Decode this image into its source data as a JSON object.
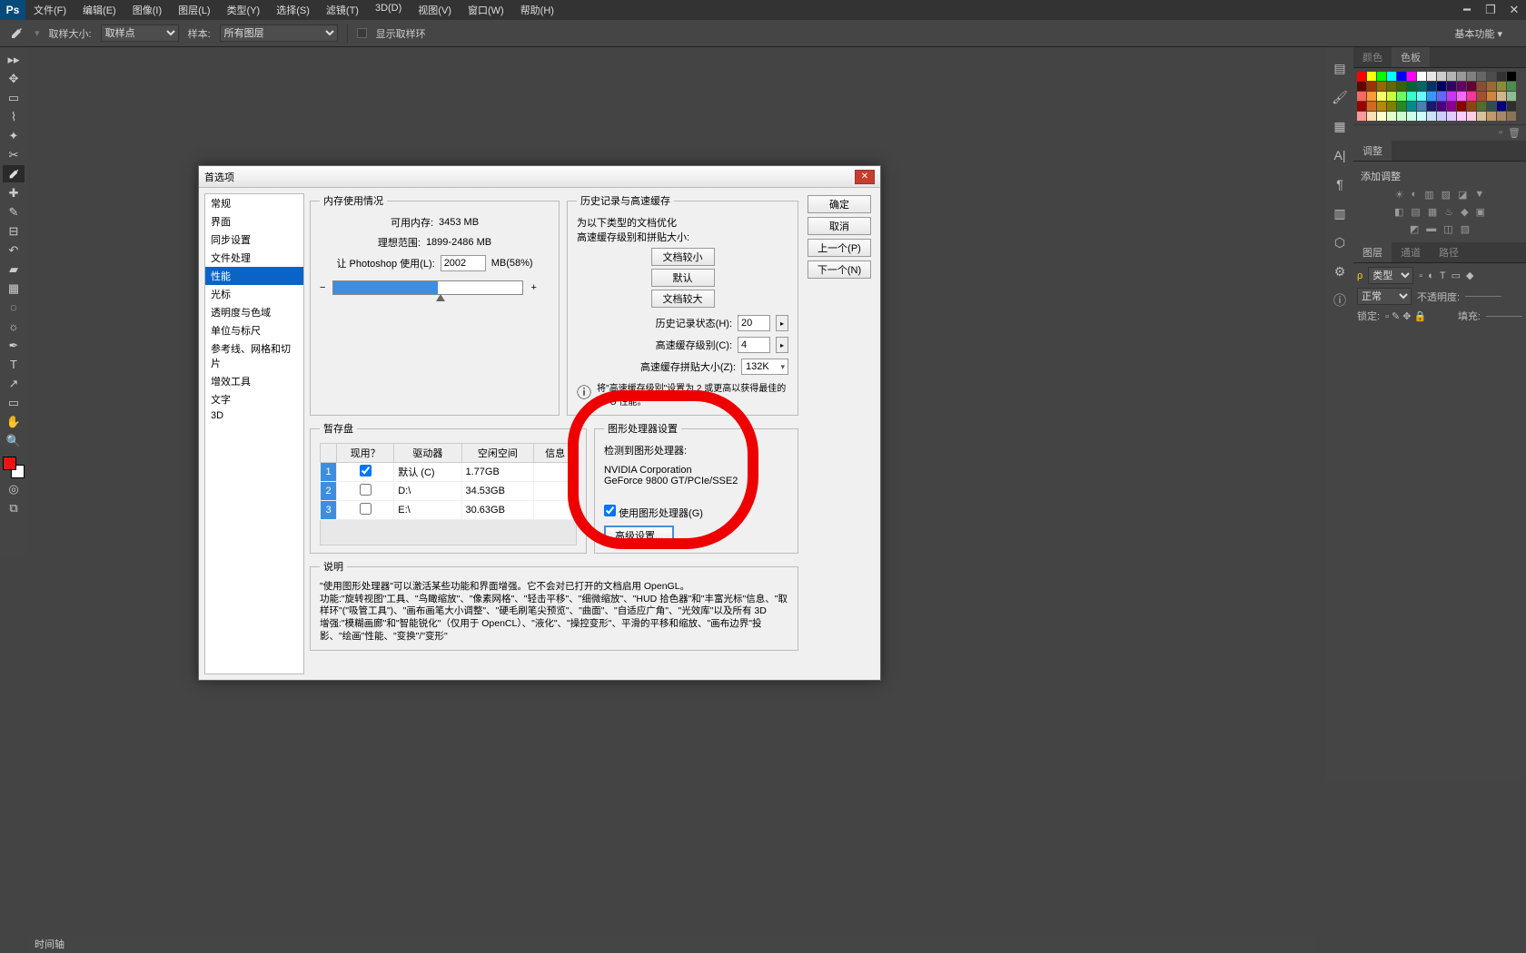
{
  "menu": [
    "文件(F)",
    "编辑(E)",
    "图像(I)",
    "图层(L)",
    "类型(Y)",
    "选择(S)",
    "滤镜(T)",
    "3D(D)",
    "视图(V)",
    "窗口(W)",
    "帮助(H)"
  ],
  "options_bar": {
    "sample_size_label": "取样大小:",
    "sample_size_value": "取样点",
    "sample_label": "样本:",
    "sample_value": "所有图层",
    "show_ring": "显示取样环",
    "basic": "基本功能"
  },
  "right_panels": {
    "color_tab": "颜色",
    "swatch_tab": "色板",
    "adjust_tab": "调整",
    "adjust_title": "添加调整",
    "layers_tab": "图层",
    "channels_tab": "通道",
    "paths_tab": "路径",
    "kind": "类型",
    "normal": "正常",
    "opacity": "不透明度:",
    "lock": "锁定:",
    "fill": "填充:"
  },
  "dialog": {
    "title": "首选项",
    "categories": [
      "常规",
      "界面",
      "同步设置",
      "文件处理",
      "性能",
      "光标",
      "透明度与色域",
      "单位与标尺",
      "参考线、网格和切片",
      "增效工具",
      "文字",
      "3D"
    ],
    "selected_category": 4,
    "buttons": {
      "ok": "确定",
      "cancel": "取消",
      "prev": "上一个(P)",
      "next": "下一个(N)"
    },
    "memory": {
      "legend": "内存使用情况",
      "available_label": "可用内存:",
      "available_value": "3453 MB",
      "ideal_label": "理想范围:",
      "ideal_value": "1899-2486 MB",
      "let_label": "让 Photoshop 使用(L):",
      "let_value": "2002",
      "let_pct": "MB(58%)"
    },
    "history": {
      "legend": "历史记录与高速缓存",
      "optimize1": "为以下类型的文档优化",
      "optimize2": "高速缓存级别和拼贴大小:",
      "small": "文档较小",
      "default": "默认",
      "large": "文档较大",
      "states_label": "历史记录状态(H):",
      "states_value": "20",
      "levels_label": "高速缓存级别(C):",
      "levels_value": "4",
      "tile_label": "高速缓存拼贴大小(Z):",
      "tile_value": "132K",
      "hint": "将\"高速缓存级别\"设置为 2 或更高以获得最佳的 GPU 性能。"
    },
    "scratch": {
      "legend": "暂存盘",
      "cols": [
        "",
        "现用？",
        "驱动器",
        "空闲空间",
        "信息"
      ],
      "rows": [
        {
          "idx": "1",
          "active": true,
          "drive": "默认 (C)",
          "free": "1.77GB"
        },
        {
          "idx": "2",
          "active": false,
          "drive": "D:\\",
          "free": "34.53GB"
        },
        {
          "idx": "3",
          "active": false,
          "drive": "E:\\",
          "free": "30.63GB"
        }
      ]
    },
    "gpu": {
      "legend": "图形处理器设置",
      "detected": "检测到图形处理器:",
      "vendor": "NVIDIA Corporation",
      "model": "GeForce 9800 GT/PCIe/SSE2",
      "use_gpu": "使用图形处理器(G)",
      "advanced": "高级设置..."
    },
    "desc": {
      "legend": "说明",
      "text": "\"使用图形处理器\"可以激活某些功能和界面增强。它不会对已打开的文档启用 OpenGL。\n功能:\"旋转视图\"工具、\"鸟瞰缩放\"、\"像素网格\"、\"轻击平移\"、\"细微缩放\"、\"HUD 拾色器\"和\"丰富光标\"信息、\"取样环\"(\"吸管工具\")、\"画布画笔大小调整\"、\"硬毛刷笔尖预览\"、\"曲面\"、\"自适应广角\"、\"光效库\"以及所有 3D\n增强:\"模糊画廊\"和\"智能锐化\"（仅用于 OpenCL）、\"液化\"、\"操控变形\"、平滑的平移和缩放、\"画布边界\"投影、\"绘画\"性能、\"变换\"/\"变形\""
    }
  },
  "status": "时间轴",
  "swatch_colors": [
    "#ff0000",
    "#ffff00",
    "#00ff00",
    "#00ffff",
    "#0000ff",
    "#ff00ff",
    "#ffffff",
    "#e6e6e6",
    "#cccccc",
    "#b3b3b3",
    "#999999",
    "#808080",
    "#666666",
    "#4d4d4d",
    "#333333",
    "#000000",
    "#660000",
    "#993300",
    "#996600",
    "#666600",
    "#336600",
    "#006633",
    "#006666",
    "#003366",
    "#000066",
    "#330066",
    "#660066",
    "#660033",
    "#8c4d2e",
    "#996b33",
    "#8c8c33",
    "#4d8c4d",
    "#ff6666",
    "#ff9933",
    "#ffff66",
    "#ccff33",
    "#66ff66",
    "#33ffcc",
    "#66ffff",
    "#3399ff",
    "#6666ff",
    "#cc33ff",
    "#ff66ff",
    "#ff3399",
    "#a0522d",
    "#cd853f",
    "#d2b48c",
    "#8fbc8f",
    "#990000",
    "#d2691e",
    "#b8860b",
    "#808000",
    "#228b22",
    "#008b8b",
    "#4682b4",
    "#191970",
    "#4b0082",
    "#8b008b",
    "#8b0000",
    "#8b4513",
    "#556b2f",
    "#2f4f4f",
    "#000080",
    "#2e2e2e",
    "#ff9999",
    "#ffe0b3",
    "#ffffcc",
    "#e0ffcc",
    "#ccffcc",
    "#ccffe6",
    "#ccffff",
    "#cce0ff",
    "#ccccff",
    "#e0ccff",
    "#ffccff",
    "#ffcce6",
    "#d9c19a",
    "#c19a6b",
    "#a8876b",
    "#8b7355"
  ]
}
